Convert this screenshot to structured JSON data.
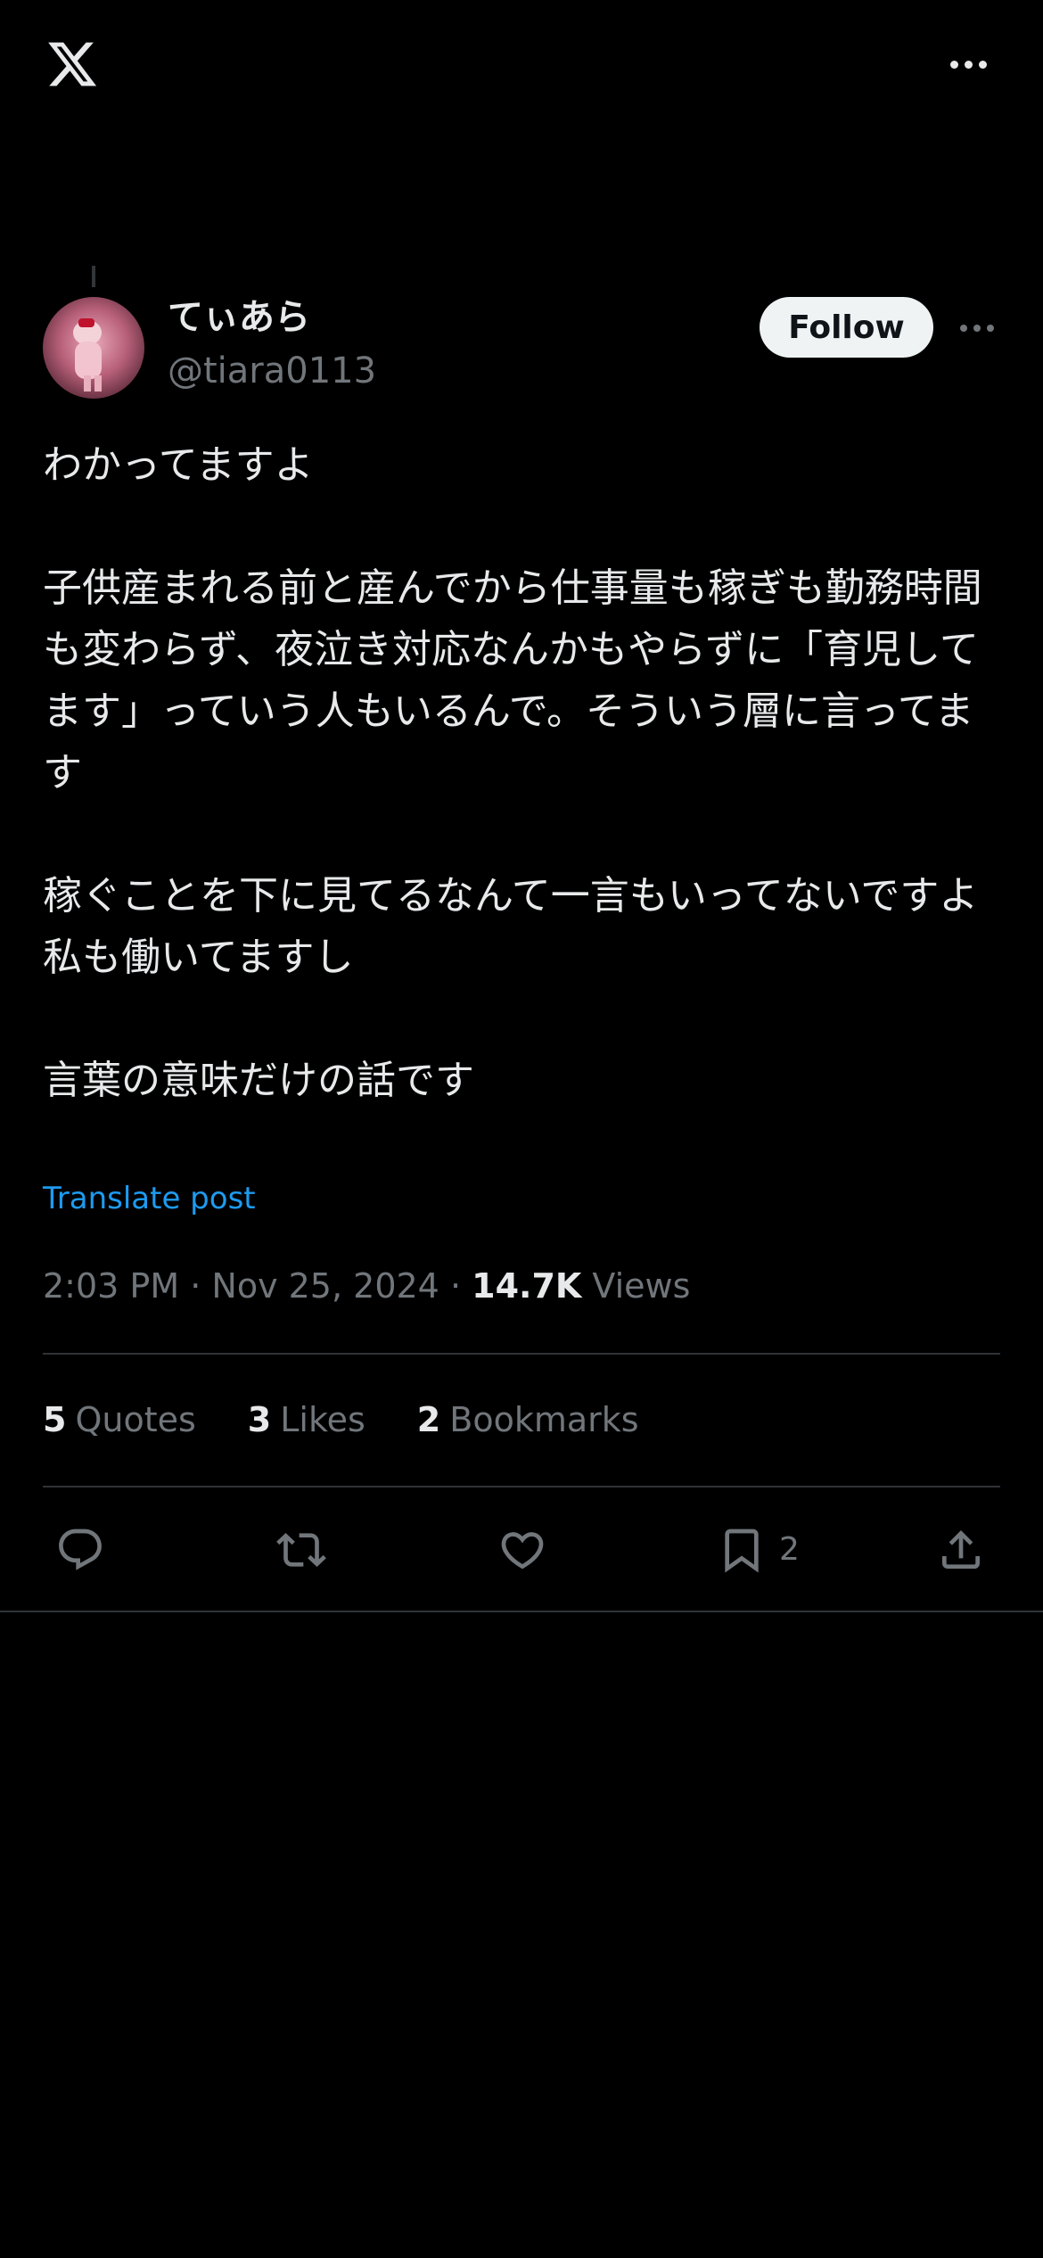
{
  "author": {
    "display_name": "てぃあら",
    "handle": "@tiara0113"
  },
  "follow_label": "Follow",
  "post": {
    "text": "わかってますよ\n\n子供産まれる前と産んでから仕事量も稼ぎも勤務時間も変わらず、夜泣き対応なんかもやらずに「育児してます」っていう人もいるんで。そういう層に言ってます\n\n稼ぐことを下に見てるなんて一言もいってないですよ\n私も働いてますし\n\n言葉の意味だけの話です",
    "translate_label": "Translate post",
    "time": "2:03 PM",
    "date": "Nov 25, 2024",
    "views_count": "14.7K",
    "views_label": "Views"
  },
  "stats": [
    {
      "count": "5",
      "label": "Quotes"
    },
    {
      "count": "3",
      "label": "Likes"
    },
    {
      "count": "2",
      "label": "Bookmarks"
    }
  ],
  "actions": {
    "reply_icon": "reply-icon",
    "repost_icon": "repost-icon",
    "like_icon": "heart-icon",
    "bookmark_icon": "bookmark-icon",
    "bookmark_count": "2",
    "share_icon": "share-icon"
  },
  "colors": {
    "background": "#000000",
    "text": "#e7e9ea",
    "secondary": "#71767b",
    "link": "#1d9bf0",
    "divider": "#2f3336"
  }
}
